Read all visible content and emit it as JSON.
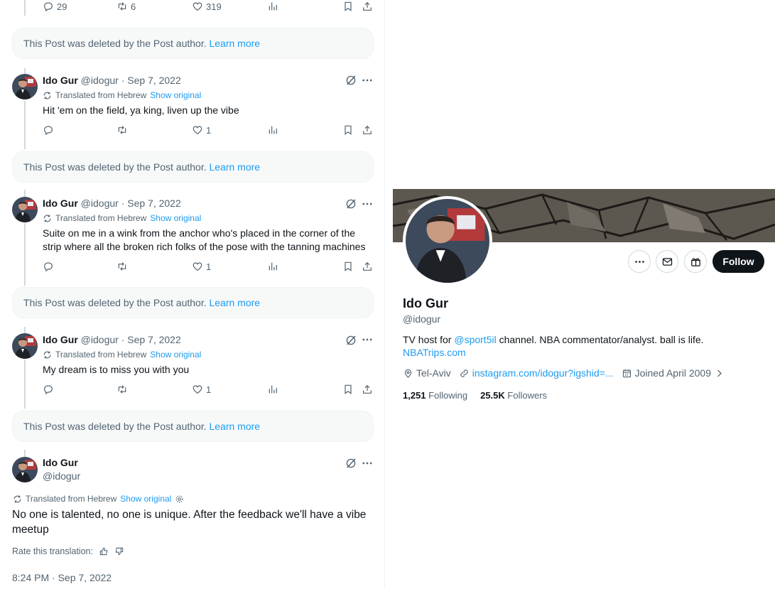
{
  "thread": {
    "top_actions": {
      "replies": "29",
      "reposts": "6",
      "likes": "319"
    },
    "deleted_notice": {
      "text": "This Post was deleted by the Post author.",
      "link": "Learn more"
    },
    "translation": {
      "label": "Translated from Hebrew",
      "show_original": "Show original"
    },
    "posts": [
      {
        "name": "Ido Gur",
        "meta": "@idogur · Sep 7, 2022",
        "text": "Hit 'em on the field, ya king, liven up the vibe",
        "likes": "1"
      },
      {
        "name": "Ido Gur",
        "meta": "@idogur · Sep 7, 2022",
        "text": "Suite on me in a wink from the anchor who's placed in the corner of the strip where all the broken rich folks of the pose with the tanning machines",
        "likes": "1"
      },
      {
        "name": "Ido Gur",
        "meta": "@idogur · Sep 7, 2022",
        "text": "My dream is to miss you with you",
        "likes": "1"
      }
    ],
    "main_post": {
      "name": "Ido Gur",
      "handle": "@idogur",
      "translated_label": "Translated from Hebrew",
      "show_original": "Show original",
      "text": "No one is talented, no one is unique. After the feedback we'll have a vibe meetup",
      "rate_label": "Rate this translation:",
      "timestamp": "8:24 PM · Sep 7, 2022"
    }
  },
  "profile": {
    "name": "Ido Gur",
    "handle": "@idogur",
    "bio_prefix": "TV host for ",
    "bio_mention": "@sport5il",
    "bio_suffix": " channel. NBA commentator/analyst. ball is life.",
    "bio_link": "NBATrips.com",
    "location": "Tel-Aviv",
    "website": "instagram.com/idogur?igshid=...",
    "joined": "Joined April 2009",
    "following_count": "1,251",
    "following_label": "Following",
    "followers_count": "25.5K",
    "followers_label": "Followers",
    "follow_button": "Follow"
  },
  "colors": {
    "accent": "#1d9bf0",
    "text": "#0f1419",
    "muted": "#536471",
    "follow_bg": "#0f1419"
  }
}
